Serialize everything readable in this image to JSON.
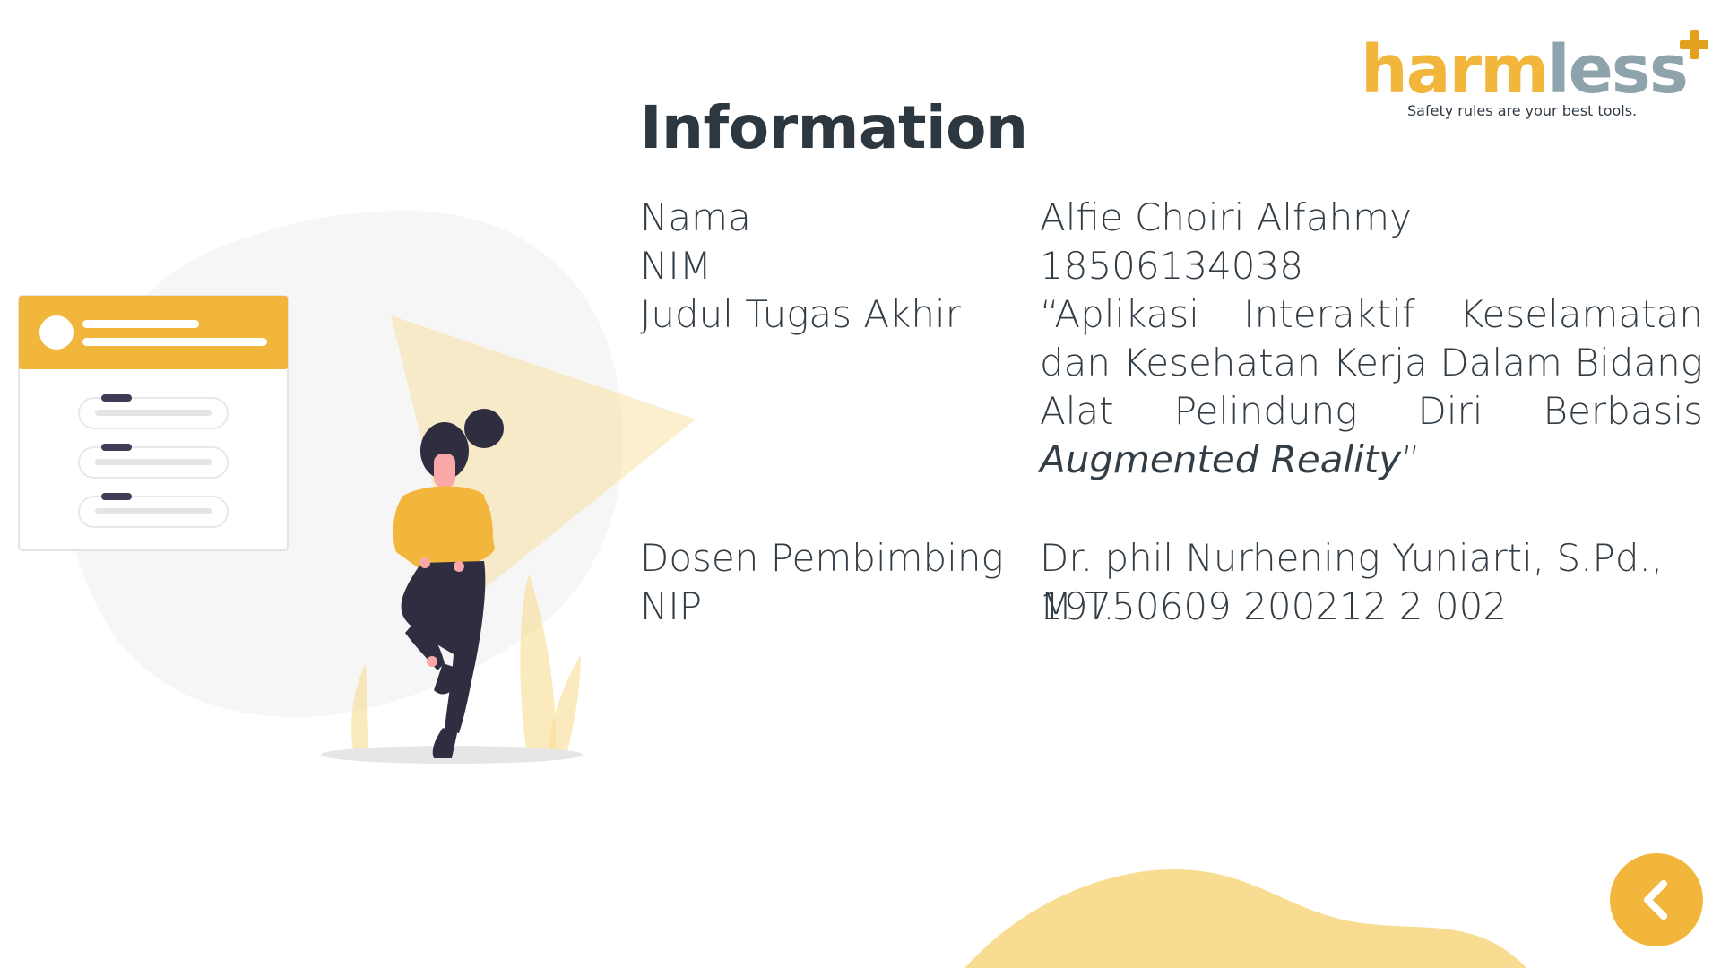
{
  "header": {
    "title": "Information"
  },
  "logo": {
    "word_part1": "harm",
    "word_part2": "less",
    "tagline": "Safety rules are your best tools."
  },
  "info": {
    "rows": [
      {
        "label": "Nama",
        "value": "Alfie Choiri Alfahmy"
      },
      {
        "label": "NIM",
        "value": "18506134038"
      },
      {
        "label": "Judul Tugas Akhir",
        "value_main": "“Aplikasi Interaktif Keselamatan dan Kesehatan Kerja Dalam Bidang Alat Pelindung Diri Berbasis ",
        "value_italic": "Augmented Reality",
        "value_end": "”"
      },
      {
        "label": "Dosen Pembimbing",
        "value": "Dr. phil Nurhening Yuniarti, S.Pd., M.T."
      },
      {
        "label": "NIP",
        "value": "19750609 200212 2 002"
      }
    ]
  },
  "navigation": {
    "back_icon": "chevron-left-icon"
  },
  "colors": {
    "accent": "#f1b63b",
    "accent_light": "#f8dc92",
    "accent_pale": "#fbf0d3",
    "logo_grey": "#8fa3ad",
    "text": "#333d45",
    "dark": "#2f2e41"
  }
}
